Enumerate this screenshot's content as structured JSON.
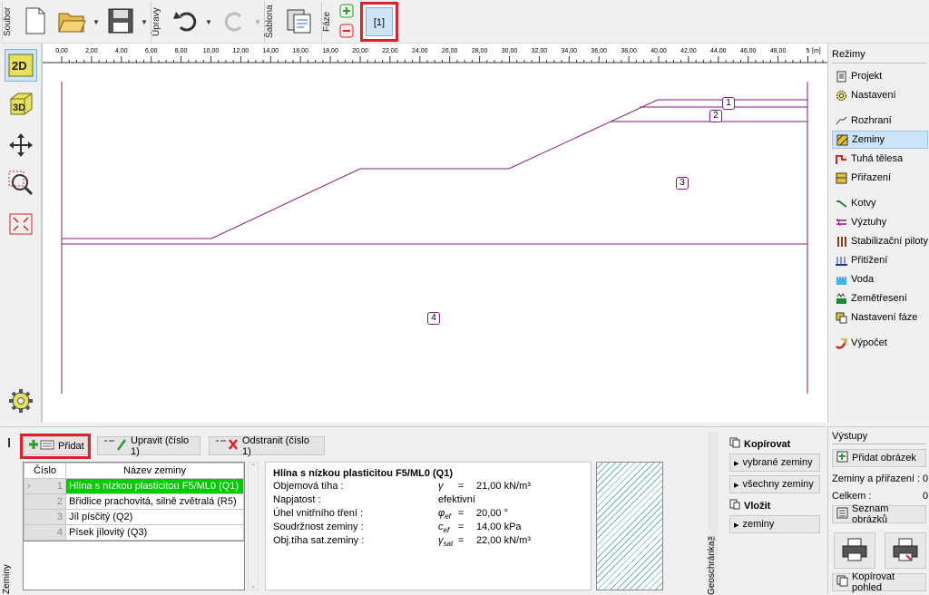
{
  "toolbar": {
    "groups": [
      "Soubor",
      "Úpravy",
      "Šablona",
      "Fáze"
    ],
    "phase_tab": "[1]"
  },
  "ruler": {
    "unit": "[m]",
    "ticks": [
      "0,00",
      "2,00",
      "4,00",
      "6,00",
      "8,00",
      "10,00",
      "12,00",
      "14,00",
      "16,00",
      "18,00",
      "20,00",
      "22,00",
      "24,00",
      "26,00",
      "28,00",
      "30,00",
      "32,00",
      "34,00",
      "36,00",
      "38,00",
      "40,00",
      "42,00",
      "44,00",
      "46,00",
      "48,00",
      "5"
    ]
  },
  "canvas": {
    "layer_labels": [
      "1",
      "2",
      "3",
      "4"
    ]
  },
  "modes": {
    "title": "Režimy",
    "items": [
      "Projekt",
      "Nastavení",
      "Rozhraní",
      "Zeminy",
      "Tuhá tělesa",
      "Přiřazení",
      "Kotvy",
      "Výztuhy",
      "Stabilizační piloty",
      "Přitížení",
      "Voda",
      "Zemětřesení",
      "Nastavení fáze",
      "Výpočet"
    ],
    "selected": "Zeminy"
  },
  "bottom": {
    "side_label": "Zeminy",
    "add": "Přidat",
    "edit": "Upravit (číslo 1)",
    "remove": "Odstranit (číslo 1)",
    "table": {
      "headers": [
        "Číslo",
        "Název zeminy"
      ],
      "rows": [
        {
          "n": "1",
          "name": "Hlína s nízkou plasticitou F5/ML0 (Q1)",
          "color": "#00cc00"
        },
        {
          "n": "2",
          "name": "Břidlice prachovitá, silně zvětralá (R5)",
          "color": "#ffffff"
        },
        {
          "n": "3",
          "name": "Jíl písčitý (Q2)",
          "color": "#ffffff"
        },
        {
          "n": "4",
          "name": "Písek jílovitý (Q3)",
          "color": "#ffffff"
        }
      ]
    },
    "props": {
      "title": "Hlína s nízkou plasticitou F5/ML0 (Q1)",
      "rows": [
        {
          "label": "Objemová tíha :",
          "sym": "γ",
          "eq": "=",
          "val": "21,00 kN/m³"
        },
        {
          "label": "Napjatost :",
          "sym": "",
          "eq": "",
          "val": "efektivní"
        },
        {
          "label": "Úhel vnitřního tření :",
          "sym": "φef",
          "eq": "=",
          "val": "20,00 °"
        },
        {
          "label": "Soudržnost zeminy :",
          "sym": "cef",
          "eq": "=",
          "val": "14,00 kPa"
        },
        {
          "label": "Obj.tíha sat.zeminy :",
          "sym": "γsat",
          "eq": "=",
          "val": "22,00 kN/m³"
        }
      ]
    }
  },
  "geoclip": {
    "label": "Geoschránka™",
    "copy": "Kopírovat",
    "sel": "vybrané zeminy",
    "all": "všechny zeminy",
    "paste": "Vložit",
    "paste_item": "zeminy"
  },
  "outputs": {
    "title": "Výstupy",
    "add_image": "Přidat obrázek",
    "soils_assign": "Zeminy a přiřazení :",
    "soils_assign_val": "0",
    "total": "Celkem :",
    "total_val": "0",
    "list": "Seznam obrázků",
    "copy_view": "Kopírovat pohled"
  }
}
